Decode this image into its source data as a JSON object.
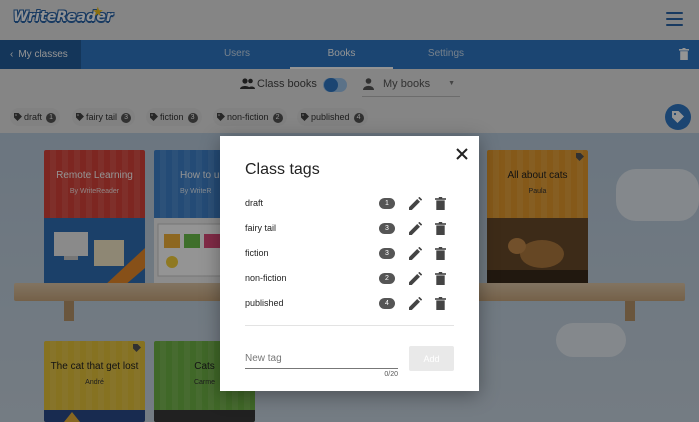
{
  "app": {
    "logo": "WriteReader"
  },
  "nav": {
    "back_label": "My classes",
    "tabs": [
      {
        "label": "Users",
        "active": false
      },
      {
        "label": "Books",
        "active": true
      },
      {
        "label": "Settings",
        "active": false
      }
    ]
  },
  "filters": {
    "class_books_label": "Class books",
    "my_books_label": "My books"
  },
  "tag_chips": [
    {
      "label": "draft",
      "count": "1"
    },
    {
      "label": "fairy tail",
      "count": "3"
    },
    {
      "label": "fiction",
      "count": "3"
    },
    {
      "label": "non-fiction",
      "count": "2"
    },
    {
      "label": "published",
      "count": "4"
    }
  ],
  "books": [
    {
      "title": "Remote Learning",
      "author": "By WriteReader",
      "color": "#d8433a"
    },
    {
      "title": "How to u",
      "author": "By WriteR",
      "color": "#3e82cc"
    },
    {
      "title": "All about cats",
      "author": "Paula",
      "color": "#e59a2b"
    },
    {
      "title": "The cat that get lost",
      "author": "André",
      "color": "#e7c43a"
    },
    {
      "title": "Cats",
      "author": "Carme",
      "color": "#6fb345"
    }
  ],
  "dialog": {
    "title": "Class tags",
    "tags": [
      {
        "name": "draft",
        "count": "1"
      },
      {
        "name": "fairy tail",
        "count": "3"
      },
      {
        "name": "fiction",
        "count": "3"
      },
      {
        "name": "non-fiction",
        "count": "2"
      },
      {
        "name": "published",
        "count": "4"
      }
    ],
    "new_tag_placeholder": "New tag",
    "new_tag_value": "",
    "char_counter": "0/20",
    "add_label": "Add"
  },
  "colors": {
    "primary": "#2f78c4",
    "nav_dark": "#235d9b",
    "logo_star": "#f2c21b"
  }
}
